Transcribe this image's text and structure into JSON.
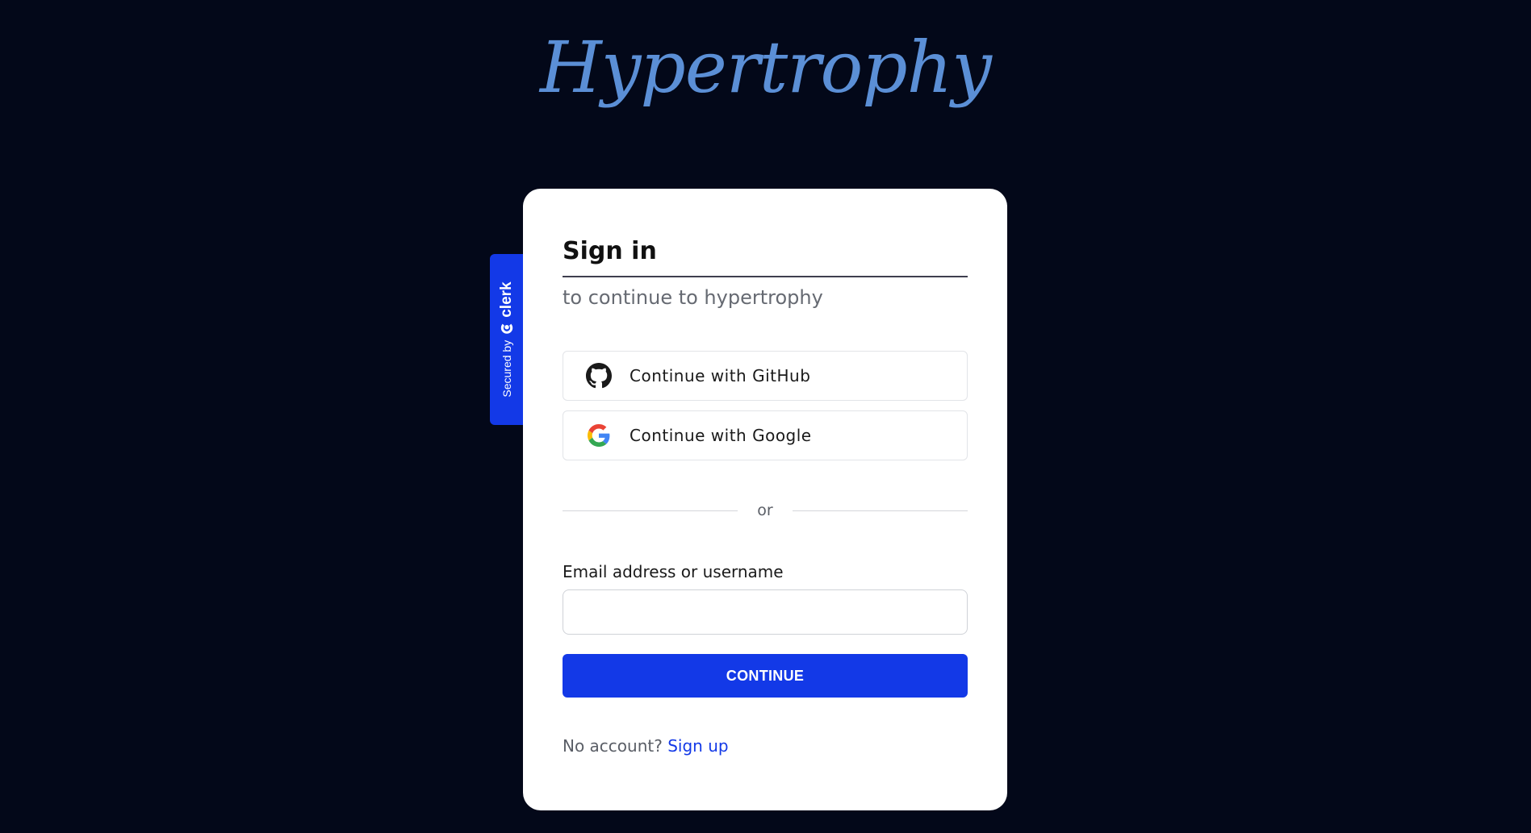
{
  "brand": {
    "logo_text": "Hypertrophy",
    "logo_color": "#5b8fd6",
    "background": "#030819",
    "accent": "#1339e7"
  },
  "secured_badge": {
    "prefix": "Secured by",
    "provider": "clerk",
    "icon": "clerk-logo-icon"
  },
  "signin": {
    "title": "Sign in",
    "subtitle": "to continue to hypertrophy",
    "social": [
      {
        "label": "Continue with GitHub",
        "icon": "github-icon"
      },
      {
        "label": "Continue with Google",
        "icon": "google-icon"
      }
    ],
    "divider_text": "or",
    "email_label": "Email address or username",
    "email_value": "",
    "email_placeholder": "",
    "continue_label": "CONTINUE",
    "footer_prompt": "No account?",
    "footer_link": "Sign up"
  }
}
